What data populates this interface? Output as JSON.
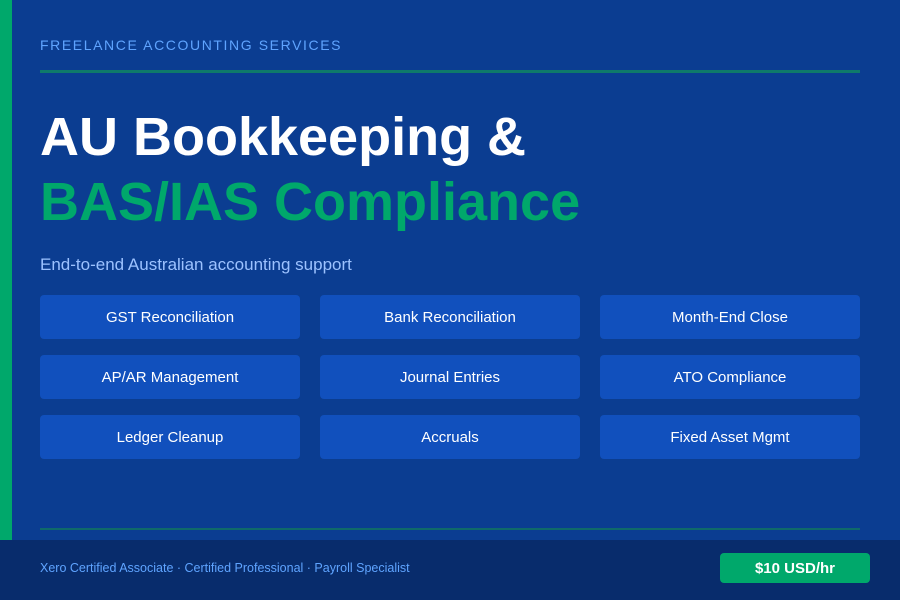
{
  "header": {
    "eyebrow": "FREELANCE ACCOUNTING SERVICES"
  },
  "hero": {
    "title_line1": "AU Bookkeeping &",
    "title_line2": "BAS/IAS Compliance",
    "subtitle": "End-to-end Australian accounting support"
  },
  "services": [
    "GST Reconciliation",
    "Bank Reconciliation",
    "Month-End Close",
    "AP/AR Management",
    "Journal Entries",
    "ATO Compliance",
    "Ledger Cleanup",
    "Accruals",
    "Fixed Asset Mgmt"
  ],
  "footer": {
    "credentials": "Xero Certified Associate · Certified Professional · Payroll Specialist",
    "rate": "$10 USD/hr"
  },
  "colors": {
    "background": "#0b3d91",
    "accent_green": "#00a86b",
    "tile": "#1150bd",
    "footer": "#082c6c",
    "eyebrow_text": "#5fa4ff"
  }
}
